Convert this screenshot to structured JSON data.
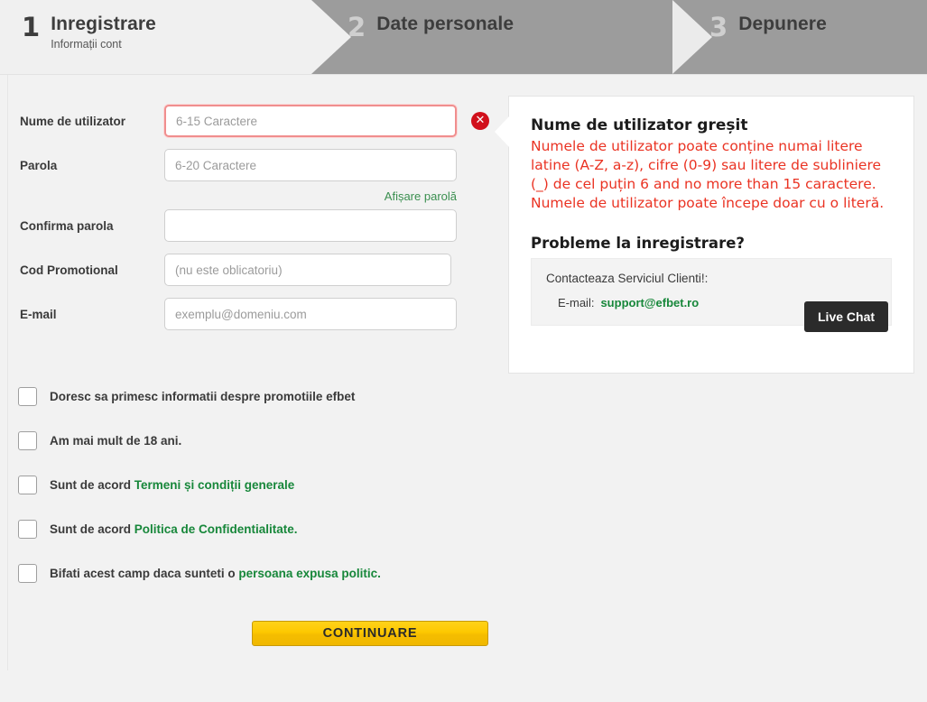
{
  "steps": [
    {
      "number": "1",
      "title": "Inregistrare",
      "subtitle": "Informații cont"
    },
    {
      "number": "2",
      "title": "Date personale",
      "subtitle": ""
    },
    {
      "number": "3",
      "title": "Depunere",
      "subtitle": ""
    }
  ],
  "form": {
    "username": {
      "label": "Nume de utilizator",
      "value": "",
      "placeholder": "6-15 Caractere",
      "error": true
    },
    "password": {
      "label": "Parola",
      "value": "",
      "placeholder": "6-20 Caractere"
    },
    "show_password_link": "Afișare parolă",
    "confirm_password": {
      "label": "Confirma parola",
      "value": "",
      "placeholder": ""
    },
    "promo_code": {
      "label": "Cod Promotional",
      "value": "",
      "placeholder": "(nu este oblicatoriu)"
    },
    "email": {
      "label": "E-mail",
      "value": "",
      "placeholder": "exemplu@domeniu.com"
    },
    "error_badge_icon": "error-x-icon"
  },
  "panel": {
    "title": "Nume de utilizator greșit",
    "error_text": "Numele de utilizator poate conține numai litere latine (A-Z, a-z), cifre (0-9) sau litere de subliniere (_) de cel puțin 6 and no more than 15 caractere. Numele de utilizator poate începe doar cu o literă.",
    "help_title": "Probleme la inregistrare?",
    "support_line": "Contacteaza Serviciul Clienti!:",
    "email_label": "E-mail:",
    "email_value": "support@efbet.ro",
    "live_chat_label": "Live Chat"
  },
  "checkboxes": [
    {
      "prefix": "Doresc sa primesc informatii despre promotiile efbet",
      "link": "",
      "suffix": "",
      "checked": false
    },
    {
      "prefix": "Am mai mult de 18 ani.",
      "link": "",
      "suffix": "",
      "checked": false
    },
    {
      "prefix": "Sunt de acord ",
      "link": "Termeni și condiții generale",
      "suffix": "",
      "checked": false
    },
    {
      "prefix": "Sunt de acord ",
      "link": "Politica de Confidentialitate.",
      "suffix": "",
      "checked": false
    },
    {
      "prefix": "Bifati acest camp daca sunteti o ",
      "link": "persoana expusa politic.",
      "suffix": "",
      "checked": false
    }
  ],
  "submit_button": "CONTINUARE",
  "colors": {
    "accent_green": "#17873a",
    "error_red": "#ea3323",
    "badge_red": "#d1101b",
    "button_yellow": "#fdc800",
    "header_gray": "#9c9c9c"
  }
}
